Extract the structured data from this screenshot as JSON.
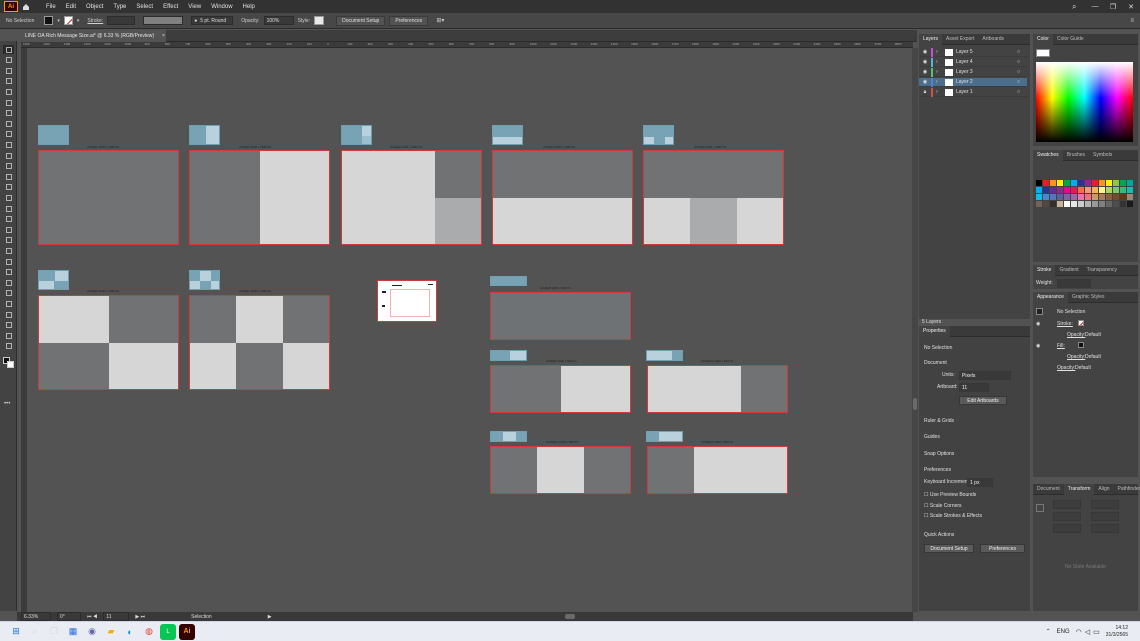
{
  "menu": {
    "items": [
      "File",
      "Edit",
      "Object",
      "Type",
      "Select",
      "Effect",
      "View",
      "Window",
      "Help"
    ]
  },
  "control": {
    "selection": "No Selection",
    "stroke_label": "Stroke:",
    "brush": "5 pt. Round",
    "opacity_label": "Opacity:",
    "opacity": "100%",
    "style_label": "Style:",
    "doc_setup": "Document Setup",
    "preferences": "Preferences"
  },
  "document": {
    "tab": "LINE OA Rich Message Size.ai* @ 6.33 % (RGB/Preview)",
    "close": "×"
  },
  "ruler_top": [
    "1500",
    "1400",
    "1300",
    "1200",
    "1100",
    "1000",
    "900",
    "800",
    "700",
    "600",
    "500",
    "400",
    "300",
    "200",
    "100",
    "0",
    "100",
    "200",
    "300",
    "400",
    "500",
    "600",
    "700",
    "800",
    "900",
    "1000",
    "1100",
    "1200",
    "1300",
    "1400",
    "1500",
    "1600",
    "1700",
    "1800",
    "1900",
    "2000",
    "2100",
    "2200",
    "2300",
    "2400",
    "2500",
    "2600",
    "2700",
    "2800"
  ],
  "artboard_labels": [
    "richMg1 1040 x 1040 Px",
    "richMg2 1040 x 1040 Px",
    "richMg3 1040 x 1040 Px",
    "richMg4 1040 x 1040 Px",
    "richMg5 1040 x 1040 Px",
    "richMg6 1040 x 1040 Px",
    "richMg7 1040 x 1040 Px",
    "richMg8 1040 x 520 Px",
    "richMg9 1040 x 520 Px",
    "richMg10 1040 x 520 Px",
    "richMg11 1040 x 520 Px",
    "richMg12 1040 x 520 Px"
  ],
  "status": {
    "zoom": "6.33%",
    "rotate": "0°",
    "artboard": "11",
    "mode": "Selection"
  },
  "layers": {
    "tabs": [
      "Layers",
      "Asset Export",
      "Artboards"
    ],
    "items": [
      {
        "name": "Layer 5",
        "color": "#c94fd6"
      },
      {
        "name": "Layer 4",
        "color": "#4fb6d6"
      },
      {
        "name": "Layer 3",
        "color": "#50c46a"
      },
      {
        "name": "Layer 2",
        "color": "#4f7fd6"
      },
      {
        "name": "Layer 1",
        "color": "#d64f4f"
      }
    ],
    "count": "5 Layers"
  },
  "properties": {
    "title": "Properties",
    "no_selection": "No Selection",
    "document": "Document",
    "units_label": "Units:",
    "units": "Pixels",
    "artboard_label": "Artboard:",
    "artboard": "11",
    "edit_artboards": "Edit Artboards",
    "ruler_grids": "Ruler & Grids",
    "guides": "Guides",
    "snap_options": "Snap Options",
    "preferences": "Preferences",
    "keyboard_increment_label": "Keyboard Increment:",
    "keyboard_increment": "1 px",
    "use_preview_bounds": "Use Preview Bounds",
    "scale_corners": "Scale Corners",
    "scale_strokes": "Scale Strokes & Effects",
    "quick_actions": "Quick Actions",
    "document_setup": "Document Setup",
    "preferences_btn": "Preferences"
  },
  "color_panel": {
    "tabs": [
      "Color",
      "Color Guide"
    ]
  },
  "swatches_panel": {
    "tabs": [
      "Swatches",
      "Brushes",
      "Symbols"
    ]
  },
  "stroke_panel": {
    "tabs": [
      "Stroke",
      "Gradient",
      "Transparency"
    ],
    "weight_label": "Weight:"
  },
  "appearance": {
    "tabs": [
      "Appearance",
      "Graphic Styles"
    ],
    "no_selection": "No Selection",
    "stroke": "Stroke:",
    "opacity": "Opacity:",
    "default": "Default",
    "fill": "Fill:"
  },
  "transform": {
    "tabs": [
      "Document",
      "Transform",
      "Align",
      "Pathfinder"
    ],
    "no_state": "No State Available"
  },
  "taskbar": {
    "lang": "ENG",
    "time": "14:12",
    "date": "31/3/2565"
  }
}
